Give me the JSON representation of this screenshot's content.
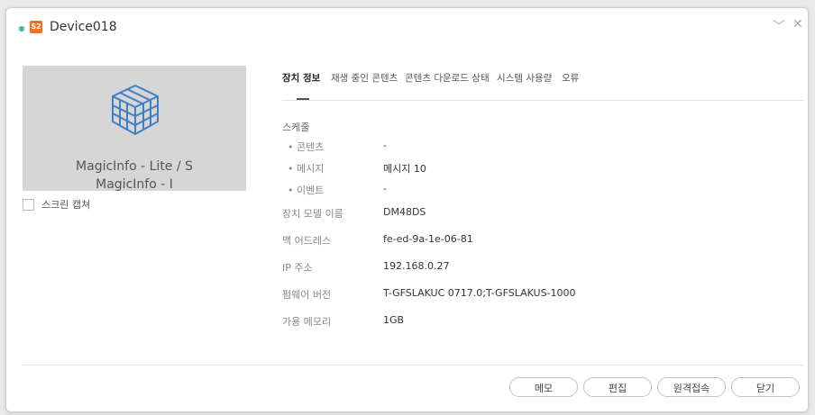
{
  "title_bar": {
    "badge": "S2",
    "device_name": "Device018",
    "collapse_glyph": "﹀",
    "close_glyph": "✕",
    "accent": "#3fb5a3",
    "badge_color": "#f36f21"
  },
  "preview": {
    "icon": "cube-icon",
    "line1": "MagicInfo - Lite / S",
    "line2": "MagicInfo - I"
  },
  "capture": {
    "label": "스크린 캡쳐"
  },
  "tabs": [
    {
      "label": "장치 정보",
      "active": true
    },
    {
      "label": "재생 중인 콘텐츠",
      "active": false
    },
    {
      "label": "콘텐츠 다운로드 상태",
      "active": false
    },
    {
      "label": "시스템 사용량",
      "active": false
    },
    {
      "label": "오류",
      "active": false
    }
  ],
  "info": {
    "schedule_label": "스케줄",
    "content_label": "콘텐츠",
    "content_value": "-",
    "message_label": "메시지",
    "message_value": "메시지 10",
    "event_label": "이벤트",
    "event_value": "-",
    "model_label": "장치 모델 이름",
    "model_value": "DM48DS",
    "mac_label": "맥 어드레스",
    "mac_value": "fe-ed-9a-1e-06-81",
    "ip_label": "IP 주소",
    "ip_value": "192.168.0.27",
    "firmware_label": "펌웨어 버전",
    "firmware_value": "T-GFSLAKUC 0717.0;T-GFSLAKUS-1000",
    "memory_label": "가용 메모리",
    "memory_value": "1GB"
  },
  "buttons": {
    "memo": "메모",
    "edit": "편집",
    "remote": "원격접속",
    "close": "닫기"
  }
}
